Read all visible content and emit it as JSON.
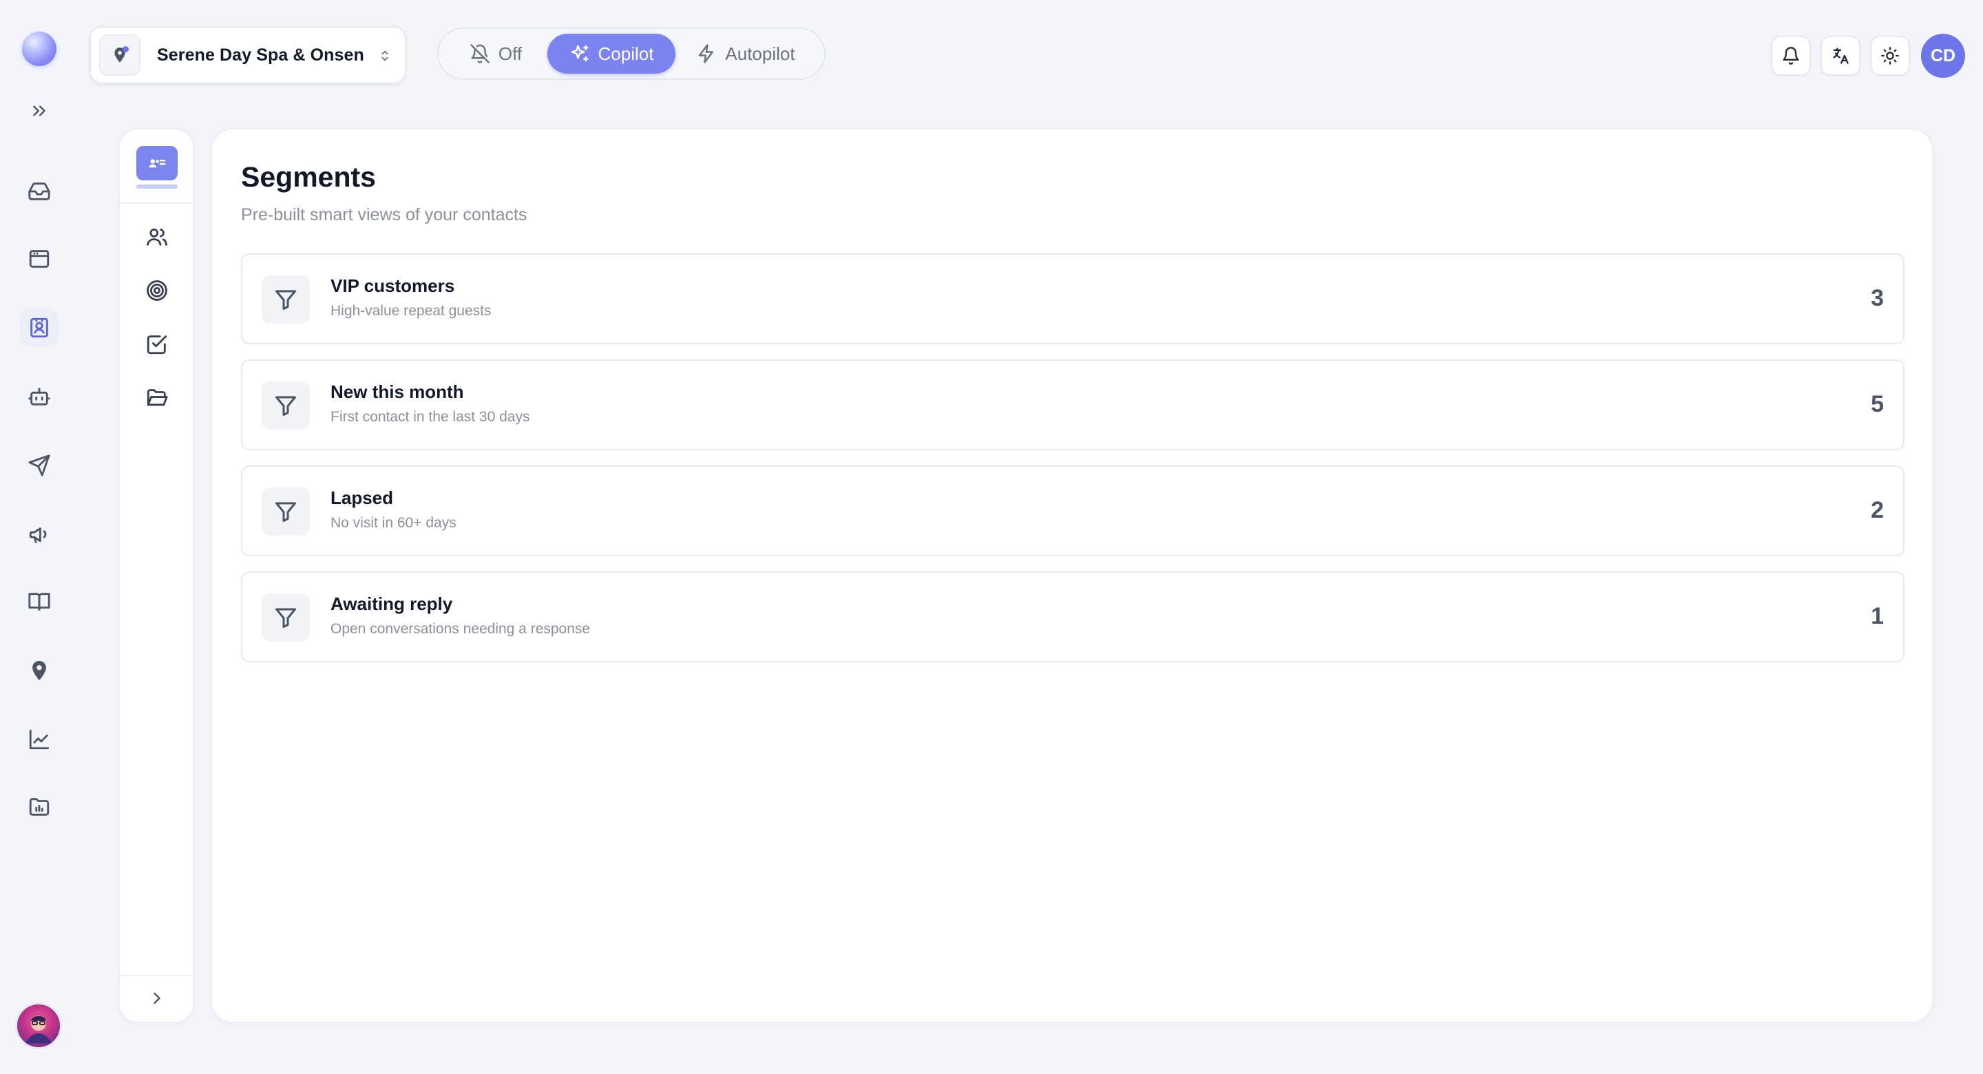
{
  "header": {
    "location_name": "Serene Day Spa & Onsen",
    "modes": [
      {
        "label": "Off",
        "icon": "bell-off-icon",
        "active": false
      },
      {
        "label": "Copilot",
        "icon": "sparkles-icon",
        "active": true
      },
      {
        "label": "Autopilot",
        "icon": "bolt-icon",
        "active": false
      }
    ],
    "user_initials": "CD"
  },
  "rail": {
    "items": [
      {
        "name": "inbox-icon",
        "active": false
      },
      {
        "name": "browser-window-icon",
        "active": false
      },
      {
        "name": "contacts-icon",
        "active": true
      },
      {
        "name": "bot-icon",
        "active": false
      },
      {
        "name": "send-icon",
        "active": false
      },
      {
        "name": "megaphone-icon",
        "active": false
      },
      {
        "name": "book-icon",
        "active": false
      },
      {
        "name": "location-pin-icon",
        "active": false
      },
      {
        "name": "chart-line-icon",
        "active": false
      },
      {
        "name": "folder-chart-icon",
        "active": false
      }
    ]
  },
  "subnav": {
    "items": [
      "contacts-card-icon",
      "users-icon",
      "target-icon",
      "checkbox-icon",
      "folder-open-icon"
    ]
  },
  "page": {
    "title": "Segments",
    "subtitle": "Pre-built smart views of your contacts"
  },
  "segments": [
    {
      "name": "VIP customers",
      "description": "High-value repeat guests",
      "count": "3"
    },
    {
      "name": "New this month",
      "description": "First contact in the last 30 days",
      "count": "5"
    },
    {
      "name": "Lapsed",
      "description": "No visit in 60+ days",
      "count": "2"
    },
    {
      "name": "Awaiting reply",
      "description": "Open conversations needing a response",
      "count": "1"
    }
  ],
  "colors": {
    "accent": "#7a83f0",
    "background": "#f3f5fb"
  }
}
